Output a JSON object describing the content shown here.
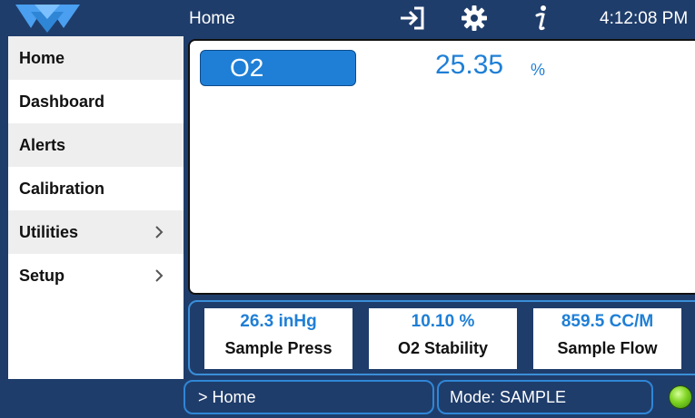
{
  "topbar": {
    "title": "Home",
    "clock": "4:12:08 PM",
    "icons": [
      "logo",
      "exit-icon",
      "gear-icon",
      "info-icon"
    ]
  },
  "sidebar": {
    "items": [
      {
        "label": "Home",
        "has_submenu": false
      },
      {
        "label": "Dashboard",
        "has_submenu": false
      },
      {
        "label": "Alerts",
        "has_submenu": false
      },
      {
        "label": "Calibration",
        "has_submenu": false
      },
      {
        "label": "Utilities",
        "has_submenu": true
      },
      {
        "label": "Setup",
        "has_submenu": true
      }
    ]
  },
  "main": {
    "gas_label": "O2",
    "gas_value": "25.35",
    "gas_unit": "%"
  },
  "meters": [
    {
      "value": "26.3 inHg",
      "label": "Sample Press"
    },
    {
      "value": "10.10 %",
      "label": "O2 Stability"
    },
    {
      "value": "859.5 CC/M",
      "label": "Sample Flow"
    }
  ],
  "statusbar": {
    "breadcrumb": "> Home",
    "mode": "Mode: SAMPLE"
  },
  "colors": {
    "frame": "#1f3d6b",
    "accent": "#1f7fd6",
    "status_led": "#7ed321"
  }
}
